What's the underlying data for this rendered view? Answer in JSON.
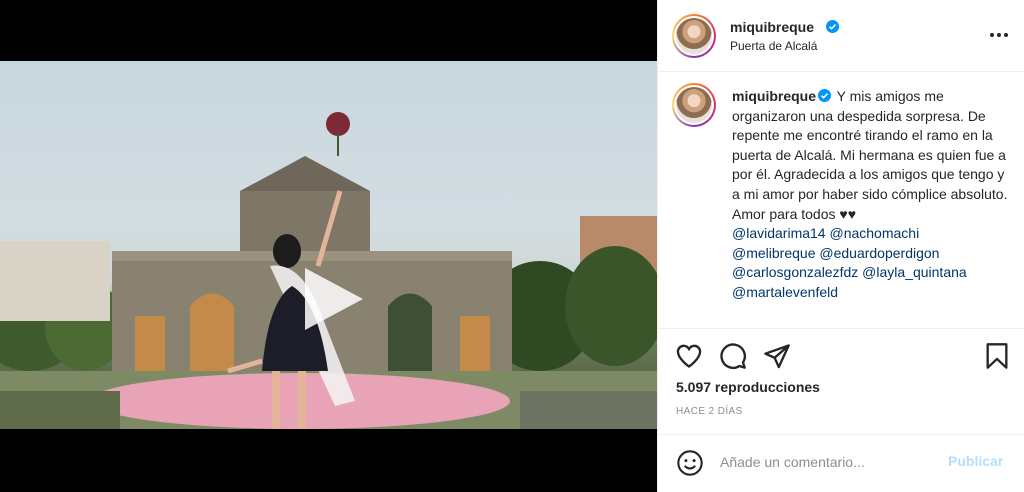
{
  "post": {
    "username": "miquibreque",
    "location": "Puerta de Alcalá",
    "verified_icon": "verified-badge-icon",
    "caption_text": "Y mis amigos me organizaron una despedida sorpresa. De repente me encontré tirando el ramo en la puerta de Alcalá. Mi hermana es quien fue a por él. Agradecida a los amigos que tengo y a mi amor por haber sido cómplice absoluto. Amor para todos ♥♥",
    "mentions": [
      "@lavidarima14",
      "@nachomachi",
      "@melibreque",
      "@eduardoperdigon",
      "@carlosgonzalezfdz",
      "@layla_quintana",
      "@martalevenfeld"
    ],
    "views": "5.097 reproducciones",
    "time_ago": "HACE 2 DÍAS"
  },
  "comment_box": {
    "placeholder": "Añade un comentario...",
    "publish_label": "Publicar"
  },
  "icons": {
    "more": "more-options-icon",
    "like": "heart-icon",
    "comment": "comment-bubble-icon",
    "share": "paper-plane-icon",
    "save": "bookmark-icon",
    "emoji": "smiley-icon",
    "play": "play-icon",
    "mute": "speaker-muted-icon"
  },
  "colors": {
    "verified_blue": "#0095f6",
    "mention_blue": "#00376b",
    "publish_disabled": "#b2dffc",
    "secondary_text": "#8e8e8e"
  }
}
